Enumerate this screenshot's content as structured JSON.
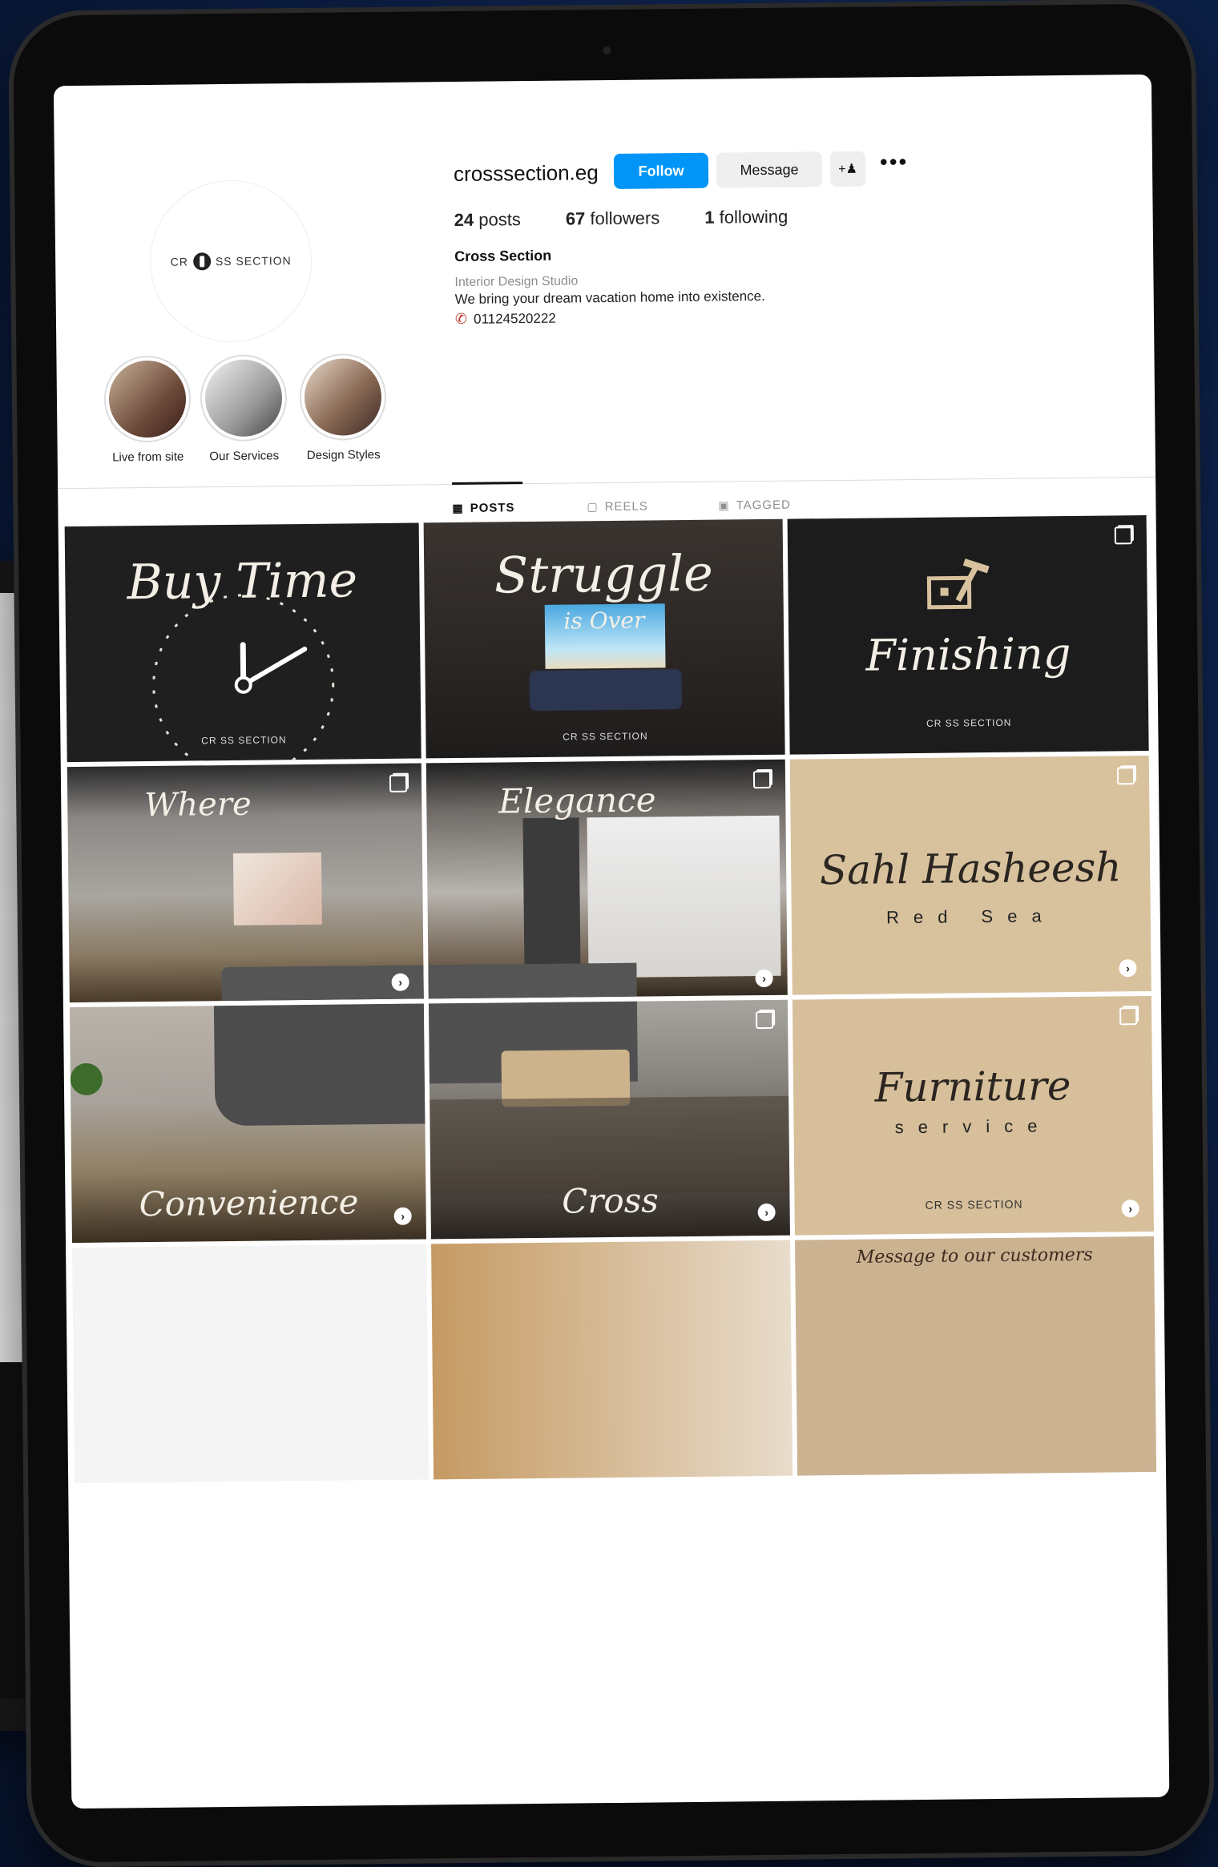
{
  "profile": {
    "username": "crosssection.eg",
    "follow_label": "Follow",
    "message_label": "Message",
    "logo_text": "CR SS SECTION",
    "posts_count": "24",
    "posts_label": "posts",
    "followers_count": "67",
    "followers_label": "followers",
    "following_count": "1",
    "following_label": "following",
    "full_name": "Cross Section",
    "category": "Interior Design Studio",
    "bio": "We bring your dream vacation home into existence.",
    "phone": "01124520222"
  },
  "highlights": [
    {
      "label": "Live from site"
    },
    {
      "label": "Our Services"
    },
    {
      "label": "Design Styles"
    }
  ],
  "tabs": [
    {
      "label": "POSTS",
      "icon": "grid-icon"
    },
    {
      "label": "REELS",
      "icon": "reels-icon"
    },
    {
      "label": "TAGGED",
      "icon": "tag-icon"
    }
  ],
  "posts": {
    "p1": {
      "title": "Buy Time",
      "logo": "CR SS SECTION"
    },
    "p2": {
      "title": "Struggle",
      "subtitle": "is Over",
      "logo": "CR SS SECTION"
    },
    "p3": {
      "title": "Finishing",
      "logo": "CR SS SECTION"
    },
    "p4": {
      "title": "Where"
    },
    "p5": {
      "title": "Elegance"
    },
    "p6": {
      "title": "Sahl Hasheesh",
      "subtitle": "Red Sea"
    },
    "p7": {
      "title": "Convenience"
    },
    "p8": {
      "title": "Cross"
    },
    "p9": {
      "title": "Furniture",
      "subtitle": "service",
      "logo": "CR SS SECTION"
    },
    "p12": {
      "title": "Message to our customers"
    }
  },
  "colors": {
    "follow_blue": "#0095f6",
    "beige_post": "#d8c29e",
    "page_bg": "#0c1f45"
  }
}
